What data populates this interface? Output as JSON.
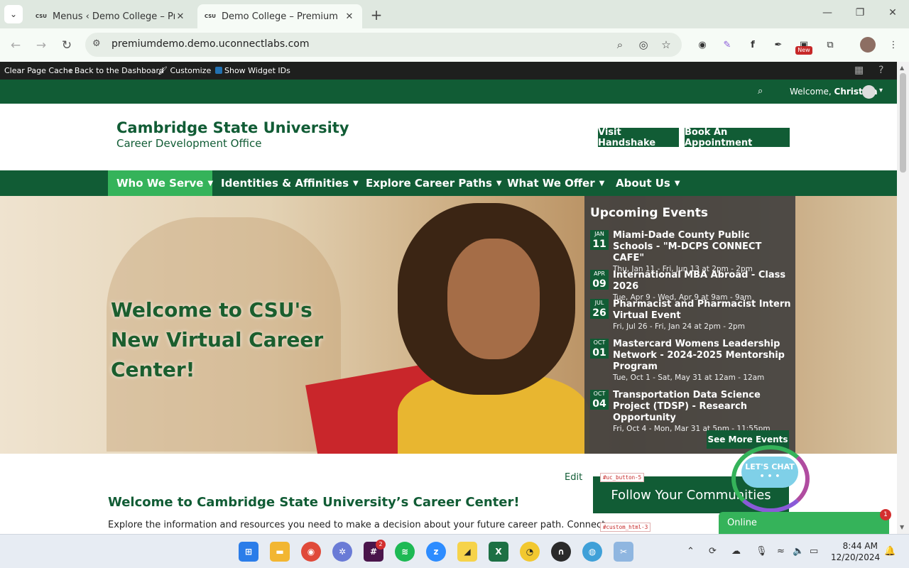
{
  "browser": {
    "tabs": [
      {
        "favicon": "CSU",
        "title": "Menus ‹ Demo College – Premi"
      },
      {
        "favicon": "CSU",
        "title": "Demo College – Premium"
      }
    ],
    "new_tab_icon": "plus-icon",
    "url": "premiumdemo.demo.uconnectlabs.com",
    "extension_new_badge": "New"
  },
  "admin_bar": {
    "clear_cache": "Clear Page Cache",
    "back_dashboard": "‹ Back to the Dashboard",
    "customize": "Customize",
    "show_widget_ids": "Show Widget IDs"
  },
  "utility_bar": {
    "welcome_prefix": "Welcome, ",
    "user_name": "Christina"
  },
  "header": {
    "university": "Cambridge State University",
    "office": "Career Development Office",
    "buttons": [
      "Visit Handshake",
      "Book An Appointment"
    ]
  },
  "nav": {
    "items": [
      "Who We Serve",
      "Identities & Affinities",
      "Explore Career Paths",
      "What We Offer",
      "About Us"
    ],
    "active_index": 0
  },
  "hero": {
    "title": "Welcome to CSU's New Virtual Career Center!"
  },
  "events": {
    "heading": "Upcoming Events",
    "items": [
      {
        "month": "JAN",
        "day": "11",
        "name": "Miami-Dade County Public Schools - \"M-DCPS CONNECT CAFE\"",
        "when": "Thu, Jan 11 - Fri, Jun 13 at 2pm - 2pm"
      },
      {
        "month": "APR",
        "day": "09",
        "name": "International MBA Abroad - Class 2026",
        "when": "Tue, Apr 9 - Wed, Apr 9 at 9am - 9am"
      },
      {
        "month": "JUL",
        "day": "26",
        "name": "Pharmacist and Pharmacist Intern Virtual Event",
        "when": "Fri, Jul 26 - Fri, Jan 24 at 2pm - 2pm"
      },
      {
        "month": "OCT",
        "day": "01",
        "name": "Mastercard Womens Leadership Network - 2024-2025 Mentorship Program",
        "when": "Tue, Oct 1 - Sat, May 31 at 12am - 12am"
      },
      {
        "month": "OCT",
        "day": "04",
        "name": "Transportation Data Science Project (TDSP) - Research Opportunity",
        "when": "Fri, Oct 4 - Mon, Mar 31 at 5pm - 11:55pm"
      }
    ],
    "see_more": "See More Events"
  },
  "content": {
    "edit": "Edit",
    "title": "Welcome to Cambridge State University’s Career Center!",
    "text": "Explore the information and resources you need to make a decision about your future career path. Connect",
    "widget_button_id": "#uc_button-5",
    "widget_html_id": "#custom_html-3",
    "follow": "Follow Your Communities"
  },
  "chat": {
    "bubble": "LET'S CHAT",
    "dots": "• • •",
    "status": "Online",
    "badge": "1"
  },
  "taskbar": {
    "chrome_badge": "",
    "slack_badge": "2",
    "time": "8:44 AM",
    "date": "12/20/2024"
  }
}
